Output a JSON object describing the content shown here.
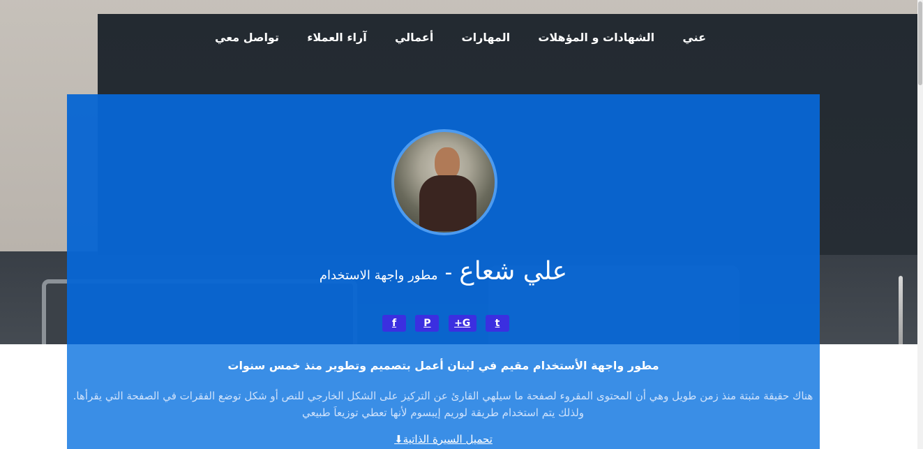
{
  "nav": {
    "items": [
      {
        "label": "عني"
      },
      {
        "label": "الشهادات و المؤهلات"
      },
      {
        "label": "المهارات"
      },
      {
        "label": "أعمالي"
      },
      {
        "label": "آراء العملاء"
      },
      {
        "label": "تواصل معي"
      }
    ]
  },
  "profile": {
    "name": "علي شعاع",
    "separator": "-",
    "role": "مطور واجهة الاستخدام"
  },
  "social": {
    "icons": [
      "facebook-icon",
      "pinterest-icon",
      "google-plus-icon",
      "twitter-icon"
    ],
    "facebook_glyph": "f",
    "pinterest_glyph": "P",
    "googleplus_glyph": "G+",
    "twitter_glyph": "t"
  },
  "about": {
    "headline": "مطور واجهة الأستخدام مقيم في لبنان أعمل بتصميم وتطوير منذ خمس سنوات",
    "bio": "هناك حقيقة مثبتة منذ زمن طويل وهي أن المحتوى المقروء لصفحة ما سيلهي القارئ عن التركيز على الشكل الخارجي للنص أو شكل توضع الفقرات في الصفحة التي يقرأها. ولذلك يتم استخدام طريقة لوريم إيبسوم لأنها تعطي توزيعاَ طبيعي",
    "download_label": "تحميل السيرة الذاتية"
  },
  "colors": {
    "card_top": "#0866d2",
    "card_bottom": "#3a8ee6",
    "social_button": "#3b2fe0"
  }
}
